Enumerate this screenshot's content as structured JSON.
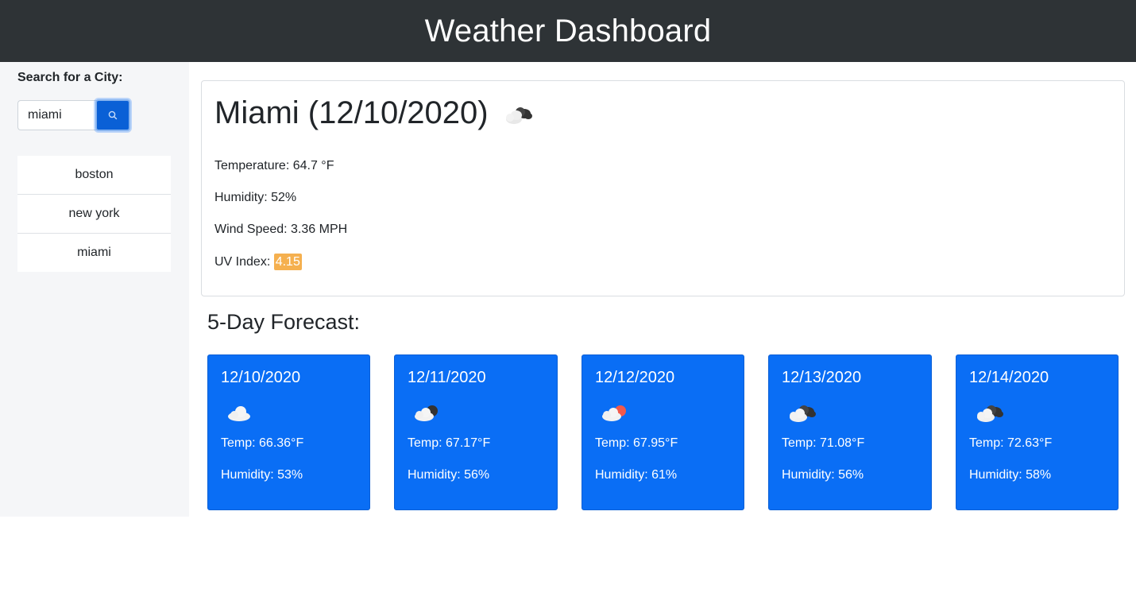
{
  "header": {
    "title": "Weather Dashboard"
  },
  "sidebar": {
    "search_label": "Search for a City:",
    "search_value": "miami",
    "search_icon": "search-icon",
    "history": [
      "boston",
      "new york",
      "miami"
    ]
  },
  "current": {
    "title": "Miami (12/10/2020)",
    "icon": "broken-clouds-icon",
    "temperature": "Temperature: 64.7 °F",
    "humidity": "Humidity: 52%",
    "wind": "Wind Speed: 3.36 MPH",
    "uv_label": "UV Index: ",
    "uv_value": "4.15",
    "uv_color": "#f5b04f"
  },
  "forecast": {
    "title": "5-Day Forecast:",
    "card_color": "#0a6ef5",
    "days": [
      {
        "date": "12/10/2020",
        "icon": "cloud-icon",
        "temp": "Temp: 66.36°F",
        "humidity": "Humidity: 53%"
      },
      {
        "date": "12/11/2020",
        "icon": "cloud-moon-icon",
        "temp": "Temp: 67.17°F",
        "humidity": "Humidity: 56%"
      },
      {
        "date": "12/12/2020",
        "icon": "cloud-sun-icon",
        "temp": "Temp: 67.95°F",
        "humidity": "Humidity: 61%"
      },
      {
        "date": "12/13/2020",
        "icon": "broken-clouds-icon",
        "temp": "Temp: 71.08°F",
        "humidity": "Humidity: 56%"
      },
      {
        "date": "12/14/2020",
        "icon": "broken-clouds-icon",
        "temp": "Temp: 72.63°F",
        "humidity": "Humidity: 58%"
      }
    ]
  }
}
